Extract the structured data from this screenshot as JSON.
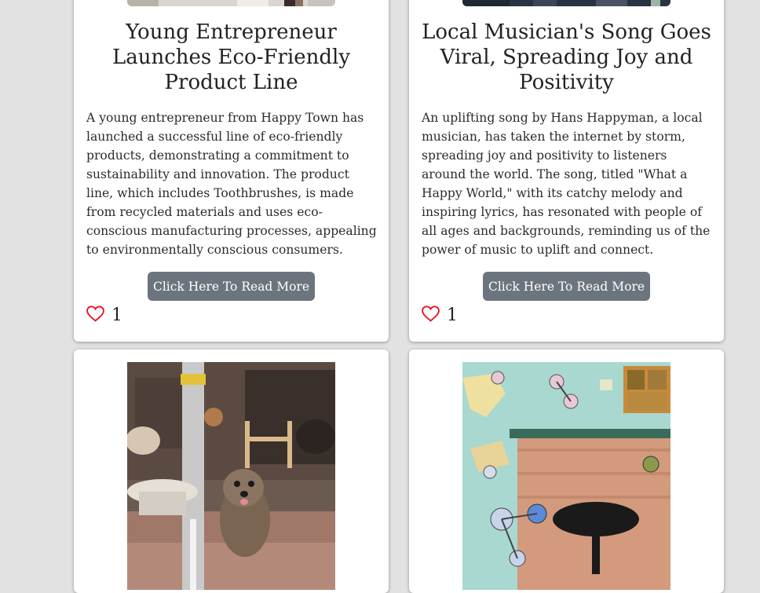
{
  "cards": [
    {
      "title": "Young Entrepreneur Launches Eco-Friendly Product Line",
      "body": "A young entrepreneur from Happy Town has launched a successful line of eco-friendly products, demonstrating a commitment to sustainability and innovation. The product line, which includes Toothbrushes, is made from recycled materials and uses eco-conscious manufacturing processes, appealing to environmentally conscious consumers.",
      "button_label": "Click Here To Read More",
      "like_count": "1"
    },
    {
      "title": "Local Musician's Song Goes Viral, Spreading Joy and Positivity",
      "body": "An uplifting song by Hans Happyman, a local musician, has taken the internet by storm, spreading joy and positivity to listeners around the world. The song, titled \"What a Happy World,\" with its catchy melody and inspiring lyrics, has resonated with people of all ages and backgrounds, reminding us of the power of music to uplift and connect.",
      "button_label": "Click Here To Read More",
      "like_count": "1"
    }
  ],
  "icons": {
    "like": "heart-outline-icon"
  },
  "colors": {
    "like_heart": "#e8131b",
    "button_bg": "#6c757d",
    "page_bg": "#e2e2e2"
  }
}
